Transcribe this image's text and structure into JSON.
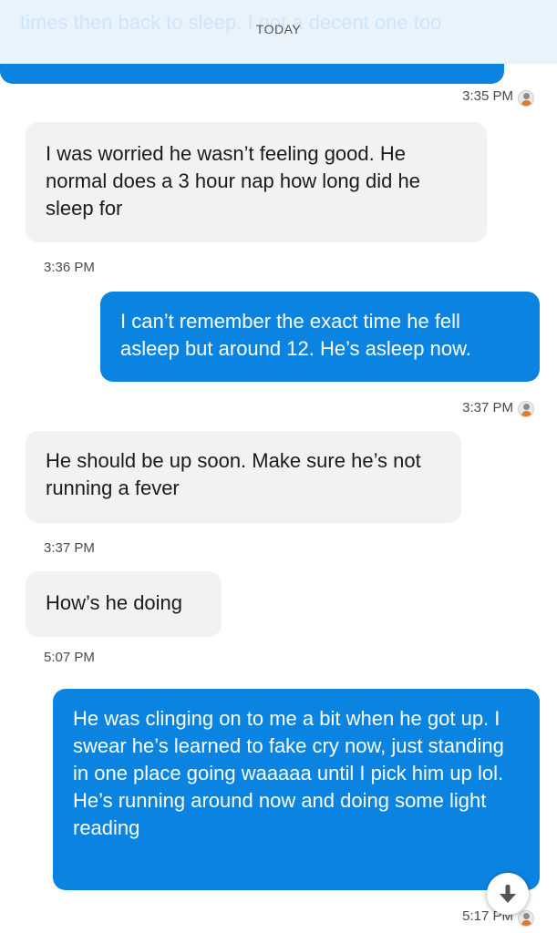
{
  "date_divider": "TODAY",
  "top_partial_message": "times then back to sleep. I got a decent one too",
  "messages": [
    {
      "direction": "outgoing",
      "time": "3:35 PM"
    },
    {
      "direction": "incoming",
      "text": "I was worried he wasn’t feeling good. He normal does a 3 hour nap how long did he sleep for",
      "time": "3:36 PM"
    },
    {
      "direction": "outgoing",
      "text": "I can’t remember the exact time he fell asleep but around 12. He’s asleep now.",
      "time": "3:37 PM"
    },
    {
      "direction": "incoming",
      "text": "He should be up soon. Make sure he’s not running a fever",
      "time": "3:37 PM"
    },
    {
      "direction": "incoming",
      "text": "How’s he doing",
      "time": "5:07 PM"
    },
    {
      "direction": "outgoing",
      "text": "He was clinging on to me a bit when he got up. I swear he’s learned to fake cry now, just standing in one place going waaaaa until I pick him up lol. He’s running around now and doing some light reading",
      "time": "5:17 PM"
    }
  ],
  "colors": {
    "outgoing": "#0a84e0",
    "incoming": "#f2f2f2"
  },
  "icons": {
    "scroll_down": "arrow-down-icon",
    "read_receipt": "avatar-icon"
  }
}
